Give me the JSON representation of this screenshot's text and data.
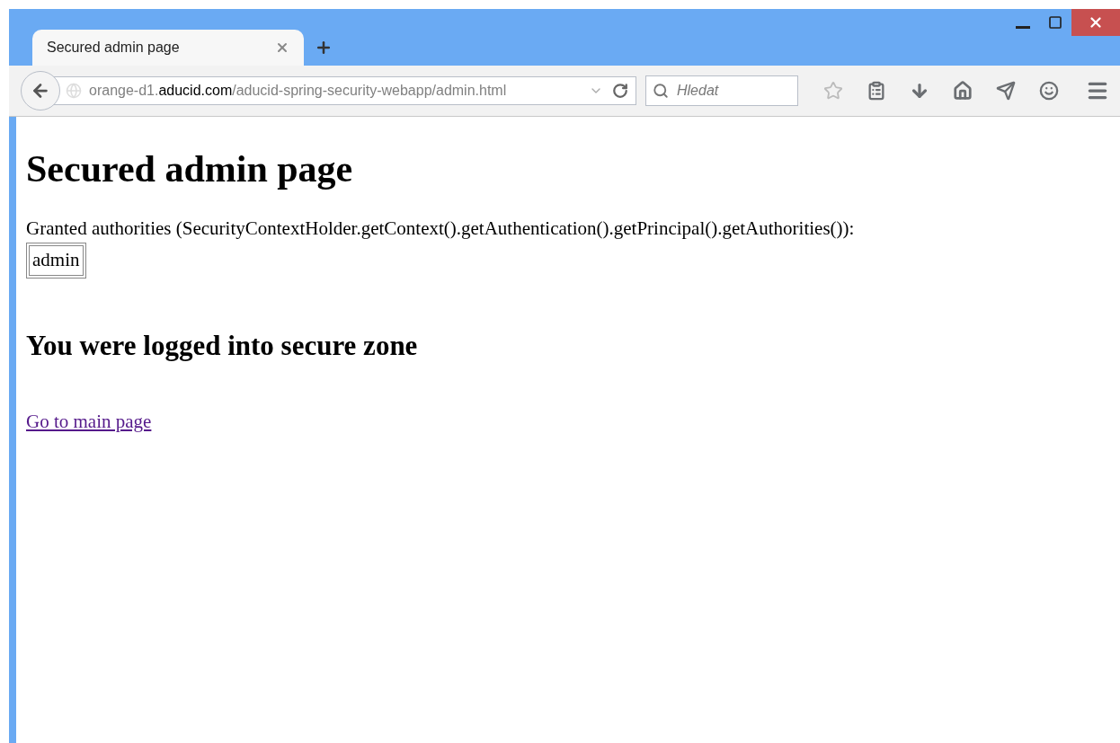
{
  "tabs": [
    {
      "label": "Secured admin page",
      "selected": true
    }
  ],
  "address_bar": {
    "prefix": "orange-d1.",
    "domain": "aducid.com",
    "path": "/aducid-spring-security-webapp/admin.html"
  },
  "search": {
    "placeholder": "Hledat"
  },
  "page": {
    "heading": "Secured admin page",
    "authorities_label": "Granted authorities (SecurityContextHolder.getContext().getAuthentication().getPrincipal().getAuthorities()):",
    "authorities": [
      "admin"
    ],
    "subheading": "You were logged into secure zone",
    "link": "Go to main page"
  }
}
